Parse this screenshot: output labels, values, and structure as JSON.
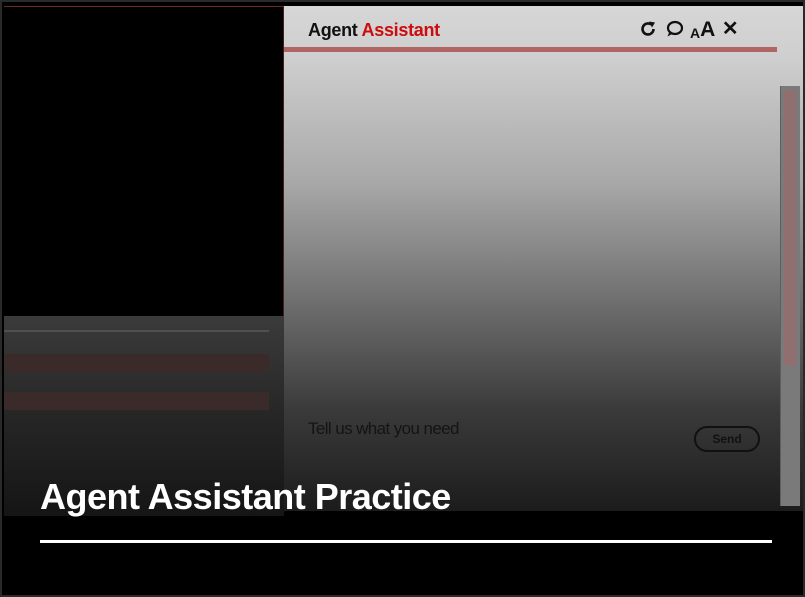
{
  "assistant": {
    "title_main": "Agent",
    "title_accent": "Assistant",
    "icons": {
      "refresh": "refresh-icon",
      "chat": "chat-bubble-icon",
      "font_size": "font-size-icon",
      "close": "close-icon"
    },
    "font_size_small": "A",
    "font_size_large": "A",
    "close_glyph": "✕",
    "input_placeholder": "Tell us what you need",
    "send_label": "Send",
    "accent_color": "#cc0d0d",
    "header_rule_color": "#b06565"
  },
  "page": {
    "title": "Agent Assistant Practice"
  }
}
